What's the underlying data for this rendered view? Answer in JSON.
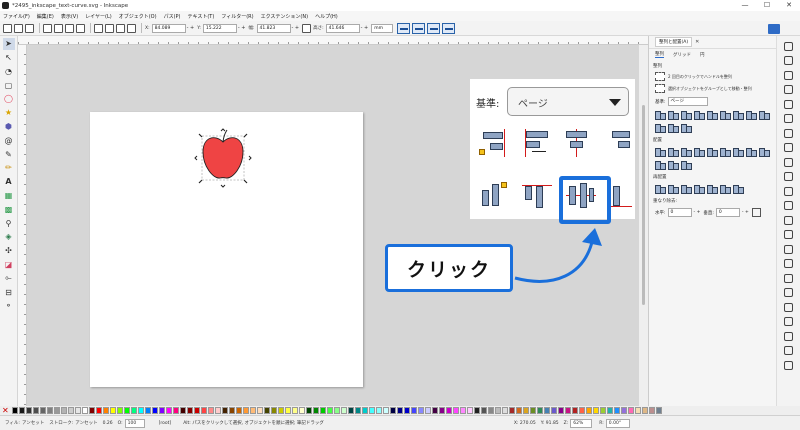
{
  "window": {
    "title": "*2495_inkscape_text-curve.svg - Inkscape",
    "controls": [
      "—",
      "☐",
      "✕"
    ]
  },
  "menu": [
    "ファイル(F)",
    "編集(E)",
    "表示(V)",
    "レイヤー(L)",
    "オブジェクト(O)",
    "パス(P)",
    "テキスト(T)",
    "フィルター(R)",
    "エクステンション(N)",
    "ヘルプ(H)"
  ],
  "toolbar": {
    "x_label": "X:",
    "x_value": "84.089",
    "y_label": "Y:",
    "y_value": "15.222",
    "w_label": "幅:",
    "w_value": "41.823",
    "h_label": "高さ:",
    "h_value": "41.646",
    "unit": "mm",
    "pm": "- +"
  },
  "inset": {
    "relative_label": "基準:",
    "relative_value": "ページ"
  },
  "callout": {
    "text": "クリック"
  },
  "panel": {
    "tab_label": "整列と配置(A)",
    "tab_close": "✕",
    "tabs": [
      "整列",
      "グリッド",
      "円"
    ],
    "section_align": "整列",
    "option1": "2 回目のクリックでハンドルを整列",
    "option2": "選択オブジェクトをグループとして移動・整列",
    "relative_label": "基準:",
    "relative_value": "ページ",
    "section_distribute": "配置",
    "section_rearrange": "再配置",
    "section_overlap": "重なり除去:",
    "h_label": "水平:",
    "h_value": "0",
    "v_label": "垂直:",
    "v_value": "0",
    "pm": "- +"
  },
  "status": {
    "fill_label": "フィル:",
    "fill_value": "アンセット",
    "stroke_label": "ストローク:",
    "stroke_value": "アンセット",
    "stroke_width": "0.26",
    "opacity_label": "O:",
    "opacity_value": "100",
    "layer": "[root]",
    "message": "Alt: パスをクリックして選択, オブジェクトを順に選択; 筆記ドラッグ",
    "coord_x": "X: 270.05",
    "coord_y": "Y: 91.85",
    "zoom_label": "Z:",
    "zoom_value": "62%",
    "rotate_label": "R:",
    "rotate_value": "0.00°"
  },
  "colors": {
    "accent": "#1a6fdb",
    "apple": "#ef4444",
    "canvas": "#d6d6d6",
    "guide": "#d31b1b"
  },
  "icons": [
    "selector-icon",
    "node-icon",
    "zoom-icon",
    "rect-icon",
    "ellipse-icon",
    "star-icon",
    "spiral-icon",
    "pencil-icon",
    "text-icon",
    "dropper-icon",
    "eraser-icon"
  ]
}
